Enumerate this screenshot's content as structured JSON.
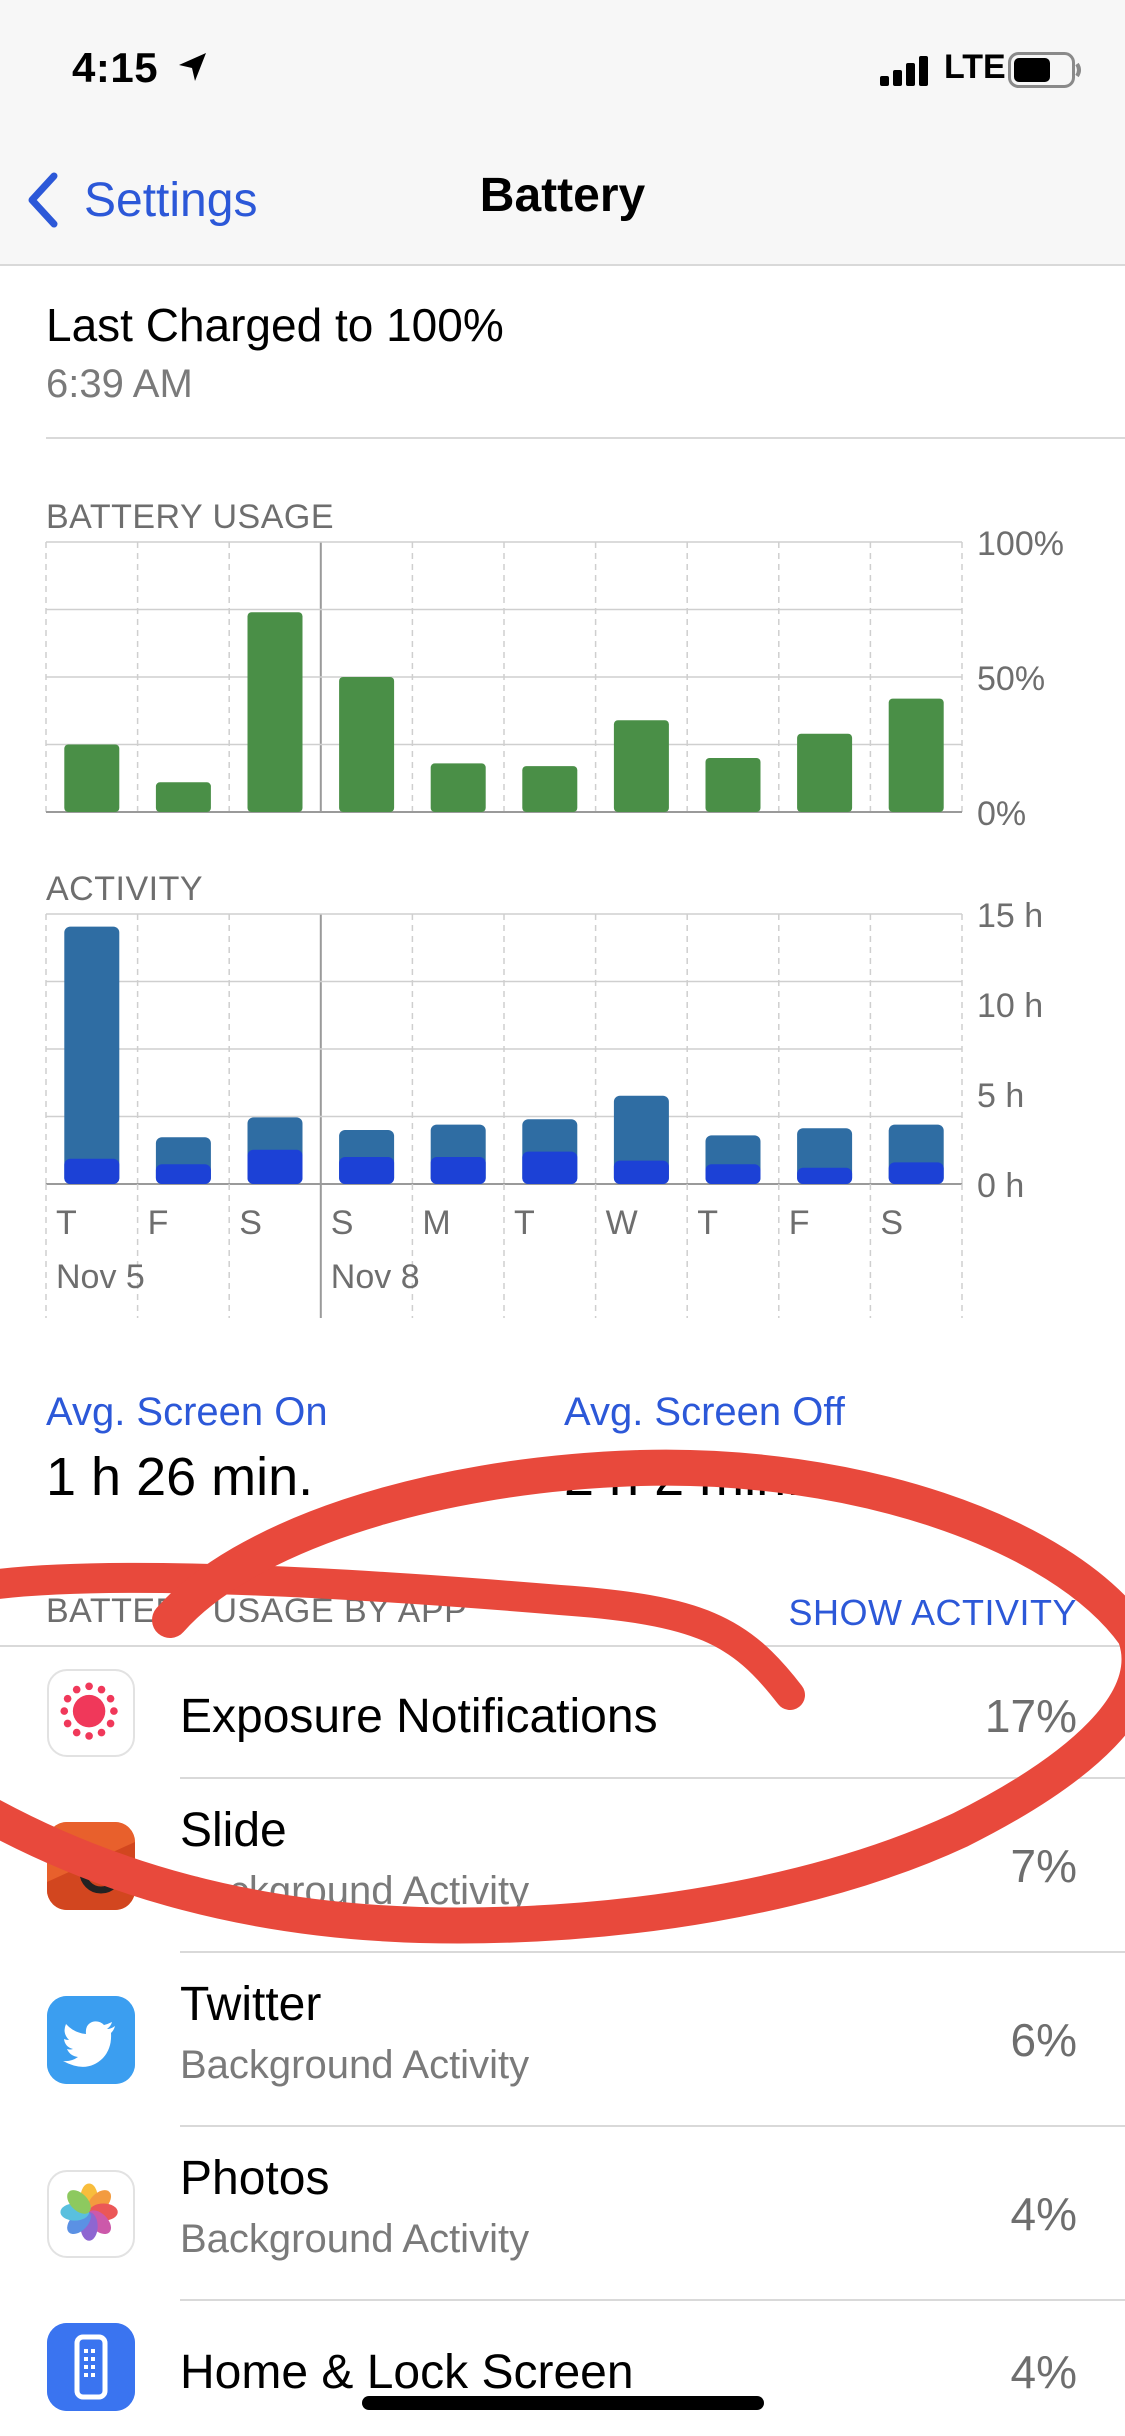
{
  "status_bar": {
    "time": "4:15",
    "network": "LTE"
  },
  "nav": {
    "back_label": "Settings",
    "title": "Battery"
  },
  "last_charged": {
    "title": "Last Charged to 100%",
    "time": "6:39 AM"
  },
  "battery_usage_label": "BATTERY USAGE",
  "activity_label": "ACTIVITY",
  "chart_data": [
    {
      "type": "bar",
      "title": "BATTERY USAGE",
      "categories": [
        "T",
        "F",
        "S",
        "S",
        "M",
        "T",
        "W",
        "T",
        "F",
        "S"
      ],
      "values": [
        25,
        11,
        74,
        50,
        18,
        17,
        34,
        20,
        29,
        42
      ],
      "ylim": [
        0,
        100
      ],
      "y_ticks": [
        "100%",
        "50%",
        "0%"
      ],
      "y_tick_values": [
        100,
        50,
        0
      ],
      "color": "#4a8f47",
      "grid": true
    },
    {
      "type": "bar",
      "title": "ACTIVITY",
      "categories": [
        "T",
        "F",
        "S",
        "S",
        "M",
        "T",
        "W",
        "T",
        "F",
        "S"
      ],
      "date_labels": [
        {
          "index": 0,
          "text": "Nov 5"
        },
        {
          "index": 3,
          "text": "Nov 8"
        }
      ],
      "series": [
        {
          "values": [
            14.3,
            2.6,
            3.7,
            3.0,
            3.3,
            3.6,
            4.9,
            2.7,
            3.1,
            3.3
          ],
          "color": "#2f6da3"
        },
        {
          "values": [
            1.4,
            1.1,
            1.9,
            1.5,
            1.5,
            1.8,
            1.3,
            1.1,
            0.9,
            1.2
          ],
          "color": "#1c41d6"
        }
      ],
      "ylim": [
        0,
        15
      ],
      "y_ticks": [
        "15 h",
        "10 h",
        "5 h",
        "0 h"
      ],
      "y_tick_values": [
        15,
        10,
        5,
        0
      ],
      "grid": true
    }
  ],
  "averages": {
    "screen_on_label": "Avg. Screen On",
    "screen_on_value": "1 h 26 min.",
    "screen_off_label": "Avg. Screen Off",
    "screen_off_value": "2 h 2 min."
  },
  "app_list": {
    "header": "BATTERY USAGE BY APP",
    "show_activity": "SHOW ACTIVITY",
    "apps": [
      {
        "name": "Exposure Notifications",
        "subtitle": "",
        "percent": "17%",
        "icon": "exposure-notifications-icon"
      },
      {
        "name": "Slide",
        "subtitle": "Background Activity",
        "percent": "7%",
        "icon": "slide-icon"
      },
      {
        "name": "Twitter",
        "subtitle": "Background Activity",
        "percent": "6%",
        "icon": "twitter-icon"
      },
      {
        "name": "Photos",
        "subtitle": "Background Activity",
        "percent": "4%",
        "icon": "photos-icon"
      },
      {
        "name": "Home & Lock Screen",
        "subtitle": "",
        "percent": "4%",
        "icon": "home-lock-screen-icon"
      }
    ]
  },
  "colors": {
    "accent": "#2c58d8",
    "battery_bar": "#4a8f47",
    "activity_screen_off": "#2f6da3",
    "activity_screen_on": "#1c41d6",
    "annotation": "#e8493c"
  }
}
